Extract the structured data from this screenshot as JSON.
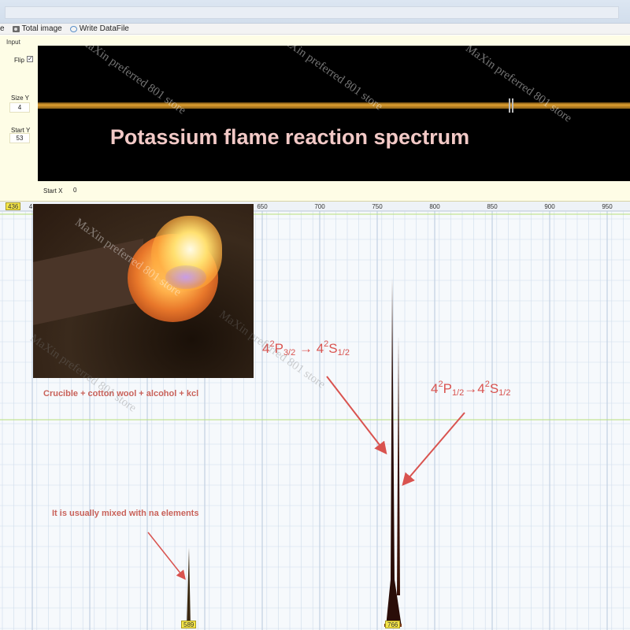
{
  "toolbar": {
    "items": [
      {
        "label": "e",
        "icon": ""
      },
      {
        "label": "Total image",
        "icon": "camera-icon"
      },
      {
        "label": "Write DataFile",
        "icon": "write-icon"
      }
    ]
  },
  "input_panel": {
    "legend": "Input",
    "flip_label": "Flip",
    "flip_checked": "✓",
    "size_y_label": "Size Y",
    "size_y_value": "4",
    "start_y_label": "Start Y",
    "start_y_value": "53",
    "start_x_label": "Start X",
    "start_x_value": "0",
    "title": "Potassium flame reaction spectrum"
  },
  "spectrum": {
    "ticks": [
      "650",
      "700",
      "750",
      "800",
      "850",
      "900",
      "950"
    ],
    "left_tag": "436",
    "left_partial_tick": "4",
    "na_tag": "589",
    "k_tag": "766",
    "na_peak_height": 0.19,
    "k_peak_height": 0.84,
    "k_secondary_height": 0.7
  },
  "annotations": {
    "photo_caption": "Crucible + cotton wool + alcohol + kcl",
    "na_note": "It is usually mixed with na elements",
    "t1_lower": {
      "n": "4",
      "sup": "2",
      "L": "P",
      "sub": "3/2"
    },
    "t1_upper": {
      "n": "4",
      "sup": "2",
      "L": "S",
      "sub": "1/2"
    },
    "t2_lower": {
      "n": "4",
      "sup": "2",
      "L": "P",
      "sub": "1/2"
    },
    "t2_upper": {
      "n": "4",
      "sup": "2",
      "L": "S",
      "sub": "1/2"
    },
    "arrow": "→"
  },
  "watermark": "MaXin preferred 801 store",
  "colors": {
    "panel_bg": "#fefde6",
    "sensor_bg": "#000000",
    "title_color": "#f2c9c6",
    "annotation_red": "#d9534f",
    "grid": "#cfdcec",
    "grid_green": "#b8e07a",
    "tag_yellow": "#f5e64a"
  }
}
